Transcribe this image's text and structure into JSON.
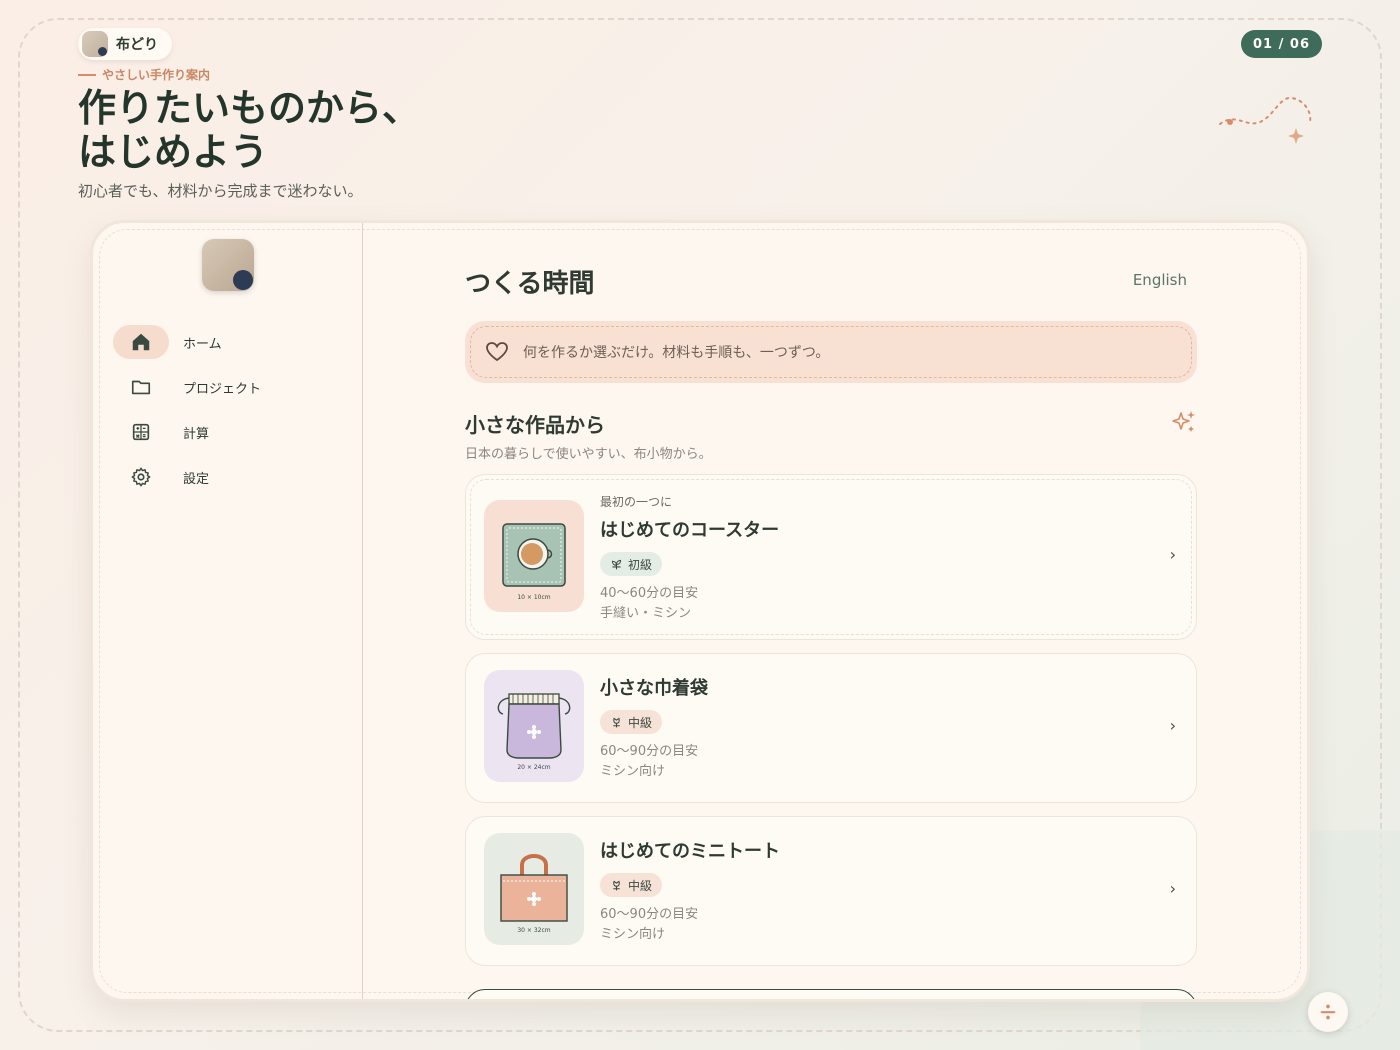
{
  "brand": {
    "name": "布どり"
  },
  "counter": "01 / 06",
  "hero": {
    "eyebrow": "やさしい手作り案内",
    "title_line1": "作りたいものから、",
    "title_line2": "はじめよう",
    "subtitle": "初心者でも、材料から完成まで迷わない。"
  },
  "sidebar": {
    "items": [
      {
        "label": "ホーム",
        "icon": "home-icon",
        "active": true
      },
      {
        "label": "プロジェクト",
        "icon": "folder-icon",
        "active": false
      },
      {
        "label": "計算",
        "icon": "calculator-icon",
        "active": false
      },
      {
        "label": "設定",
        "icon": "gear-icon",
        "active": false
      }
    ]
  },
  "main": {
    "title": "つくる時間",
    "language_link": "English",
    "banner": "何を作るか選ぶだけ。材料も手順も、一つずつ。",
    "section_title": "小さな作品から",
    "section_subtitle": "日本の暮らしで使いやすい、布小物から。",
    "cards": [
      {
        "eyebrow": "最初の一つに",
        "title": "はじめてのコースター",
        "level": "初級",
        "time": "40〜60分の目安",
        "method": "手縫い・ミシン",
        "size": "10 × 10cm",
        "thumb_color": "#f7dfd3"
      },
      {
        "title": "小さな巾着袋",
        "level": "中級",
        "time": "60〜90分の目安",
        "method": "ミシン向け",
        "size": "20 × 24cm",
        "thumb_color": "#ece4f1"
      },
      {
        "title": "はじめてのミニトート",
        "level": "中級",
        "time": "60〜90分の目安",
        "method": "ミシン向け",
        "size": "30 × 32cm",
        "thumb_color": "#e6ece4"
      }
    ]
  },
  "colors": {
    "accent": "#3f6b5a",
    "coral": "#d88c6a",
    "background": "#f7f1ea"
  }
}
